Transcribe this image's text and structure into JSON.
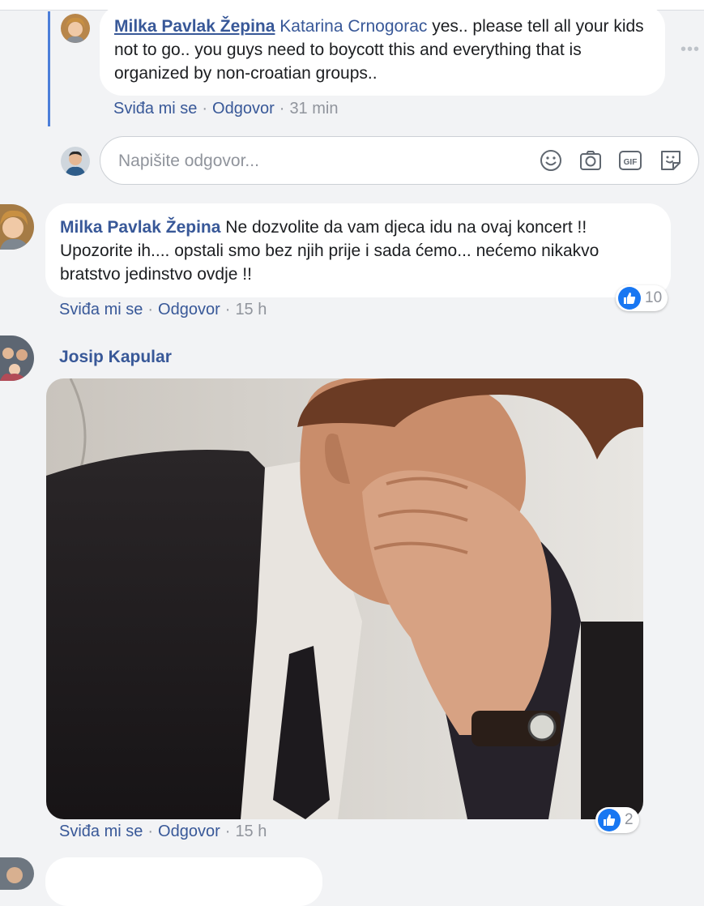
{
  "reply": {
    "author": "Milka Pavlak Žepina",
    "mention": "Katarina Crnogorac",
    "text": " yes.. please tell all your kids not to go.. you guys need to boycott this and everything that is organized by non-croatian groups..",
    "actions": {
      "like": "Sviđa mi se",
      "reply": "Odgovor",
      "time": "31 min"
    }
  },
  "composer": {
    "placeholder": "Napišite odgovor...",
    "icons": [
      "emoji-icon",
      "camera-icon",
      "gif-icon",
      "sticker-icon"
    ]
  },
  "comment1": {
    "author": "Milka Pavlak Žepina",
    "text": " Ne dozvolite da vam djeca idu na ovaj koncert !! Upozorite ih.... opstali smo bez njih prije i sada ćemo... nećemo nikakvo bratstvo jedinstvo ovdje !!",
    "actions": {
      "like": "Sviđa mi se",
      "reply": "Odgovor",
      "time": "15 h"
    },
    "likes": "10"
  },
  "comment2": {
    "author": "Josip Kapular",
    "actions": {
      "like": "Sviđa mi se",
      "reply": "Odgovor",
      "time": "15 h"
    },
    "likes": "2"
  },
  "colors": {
    "link": "#385898",
    "like": "#1877f2",
    "thread": "#4c7ed9",
    "background": "#f2f3f5"
  }
}
